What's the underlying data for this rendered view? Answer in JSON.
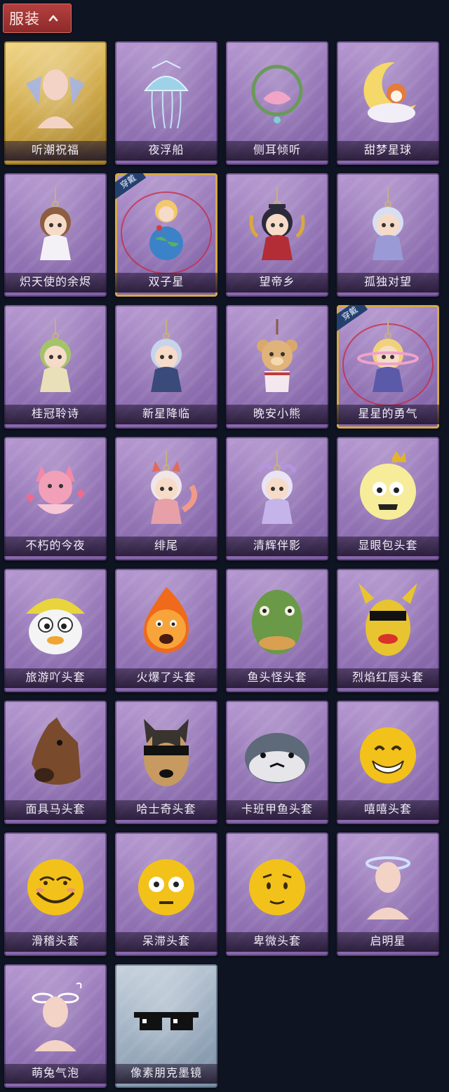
{
  "header": {
    "title": "服装",
    "icon": "chevron-up-icon"
  },
  "badge_text": "穿戴",
  "colors": {
    "page_bg": "#0f1422",
    "tab_red": "#a3343a",
    "card_purple": "#9a7bbb",
    "card_gold": "#cfa94a",
    "card_silver": "#9fb0c2",
    "worn_border": "#d4a94a"
  },
  "items": [
    {
      "name": "听潮祝福",
      "tier": "gold",
      "worn": false,
      "icon": "avatar-wings-icon"
    },
    {
      "name": "夜浮船",
      "tier": "purple",
      "worn": false,
      "icon": "jellyfish-icon"
    },
    {
      "name": "侧耳倾听",
      "tier": "purple",
      "worn": false,
      "icon": "lotus-wreath-icon"
    },
    {
      "name": "甜梦星球",
      "tier": "purple",
      "worn": false,
      "icon": "moon-fox-icon"
    },
    {
      "name": "炽天使的余烬",
      "tier": "purple",
      "worn": false,
      "icon": "angel-doll-icon"
    },
    {
      "name": "双子星",
      "tier": "purple",
      "worn": true,
      "icon": "planet-doll-icon"
    },
    {
      "name": "望帝乡",
      "tier": "purple",
      "worn": false,
      "icon": "emperor-doll-icon"
    },
    {
      "name": "孤独对望",
      "tier": "purple",
      "worn": false,
      "icon": "silver-hair-doll-icon"
    },
    {
      "name": "桂冠聆诗",
      "tier": "purple",
      "worn": false,
      "icon": "laurel-doll-icon"
    },
    {
      "name": "新星降临",
      "tier": "purple",
      "worn": false,
      "icon": "star-doll-icon"
    },
    {
      "name": "晚安小熊",
      "tier": "purple",
      "worn": false,
      "icon": "teddy-bear-icon"
    },
    {
      "name": "星星的勇气",
      "tier": "purple",
      "worn": true,
      "icon": "saturn-doll-icon"
    },
    {
      "name": "不朽的今夜",
      "tier": "purple",
      "worn": false,
      "icon": "pink-fox-icon"
    },
    {
      "name": "绯尾",
      "tier": "purple",
      "worn": false,
      "icon": "fox-girl-icon"
    },
    {
      "name": "清辉伴影",
      "tier": "purple",
      "worn": false,
      "icon": "moon-girl-icon"
    },
    {
      "name": "显眼包头套",
      "tier": "purple",
      "worn": false,
      "icon": "crown-head-icon"
    },
    {
      "name": "旅游吖头套",
      "tier": "purple",
      "worn": false,
      "icon": "duck-hat-icon"
    },
    {
      "name": "火爆了头套",
      "tier": "purple",
      "worn": false,
      "icon": "fire-head-icon"
    },
    {
      "name": "鱼头怪头套",
      "tier": "purple",
      "worn": false,
      "icon": "fish-mask-icon"
    },
    {
      "name": "烈焰红唇头套",
      "tier": "purple",
      "worn": false,
      "icon": "pikachu-lips-icon"
    },
    {
      "name": "面具马头套",
      "tier": "purple",
      "worn": false,
      "icon": "horse-mask-icon"
    },
    {
      "name": "哈士奇头套",
      "tier": "purple",
      "worn": false,
      "icon": "husky-mask-icon"
    },
    {
      "name": "卡班甲鱼头套",
      "tier": "purple",
      "worn": false,
      "icon": "turtle-head-icon"
    },
    {
      "name": "嘻嘻头套",
      "tier": "purple",
      "worn": false,
      "icon": "grin-head-icon"
    },
    {
      "name": "滑稽头套",
      "tier": "purple",
      "worn": false,
      "icon": "funny-face-icon"
    },
    {
      "name": "呆滞头套",
      "tier": "purple",
      "worn": false,
      "icon": "dazed-face-icon"
    },
    {
      "name": "卑微头套",
      "tier": "purple",
      "worn": false,
      "icon": "humble-face-icon"
    },
    {
      "name": "启明星",
      "tier": "purple",
      "worn": false,
      "icon": "halo-avatar-icon"
    },
    {
      "name": "萌兔气泡",
      "tier": "purple",
      "worn": false,
      "icon": "bunny-avatar-icon"
    },
    {
      "name": "像素朋克墨镜",
      "tier": "silver",
      "worn": false,
      "icon": "pixel-sunglasses-icon"
    }
  ]
}
